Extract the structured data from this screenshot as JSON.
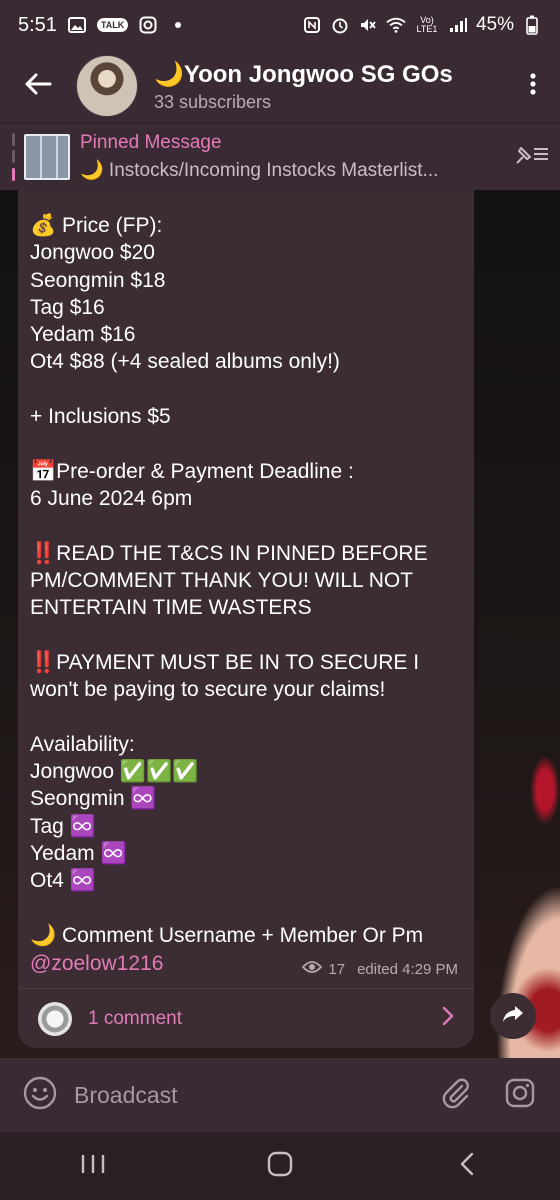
{
  "status_bar": {
    "time": "5:51",
    "battery": "45%",
    "left_icons": [
      "gallery-icon",
      "talk-icon",
      "instagram-icon",
      "dot-icon"
    ],
    "right_icons": [
      "nfc-icon",
      "alarm-icon",
      "mute-icon",
      "wifi-icon",
      "volte-icon",
      "signal-icon"
    ]
  },
  "header": {
    "title": "🌙Yoon Jongwoo SG GOs",
    "subscribers": "33 subscribers"
  },
  "pinned": {
    "title": "Pinned Message",
    "text": "🌙 Instocks/Incoming Instocks Masterlist..."
  },
  "message": {
    "body": "💰 Price (FP):\nJongwoo $20\nSeongmin $18\nTag $16\nYedam $16\nOt4 $88 (+4 sealed albums only!)\n\n+ Inclusions $5\n\n📅Pre-order & Payment Deadline :\n6 June 2024 6pm\n\n‼️READ THE T&CS IN PINNED BEFORE PM/COMMENT THANK YOU! WILL NOT ENTERTAIN TIME WASTERS\n\n‼️PAYMENT MUST BE IN TO SECURE I won't be paying to secure your claims!\n\nAvailability:\nJongwoo ✅✅✅\nSeongmin ♾️\nTag ♾️\nYedam ♾️\nOt4 ♾️\n\n🌙 Comment Username + Member Or Pm",
    "mention": "@zoelow1216",
    "views": "17",
    "edited": "edited 4:29 PM",
    "comments": "1 comment"
  },
  "input": {
    "placeholder": "Broadcast"
  },
  "colors": {
    "accent": "#e27bb8",
    "header_bg": "#3a2a33",
    "bubble_bg": "#3c2d35"
  }
}
